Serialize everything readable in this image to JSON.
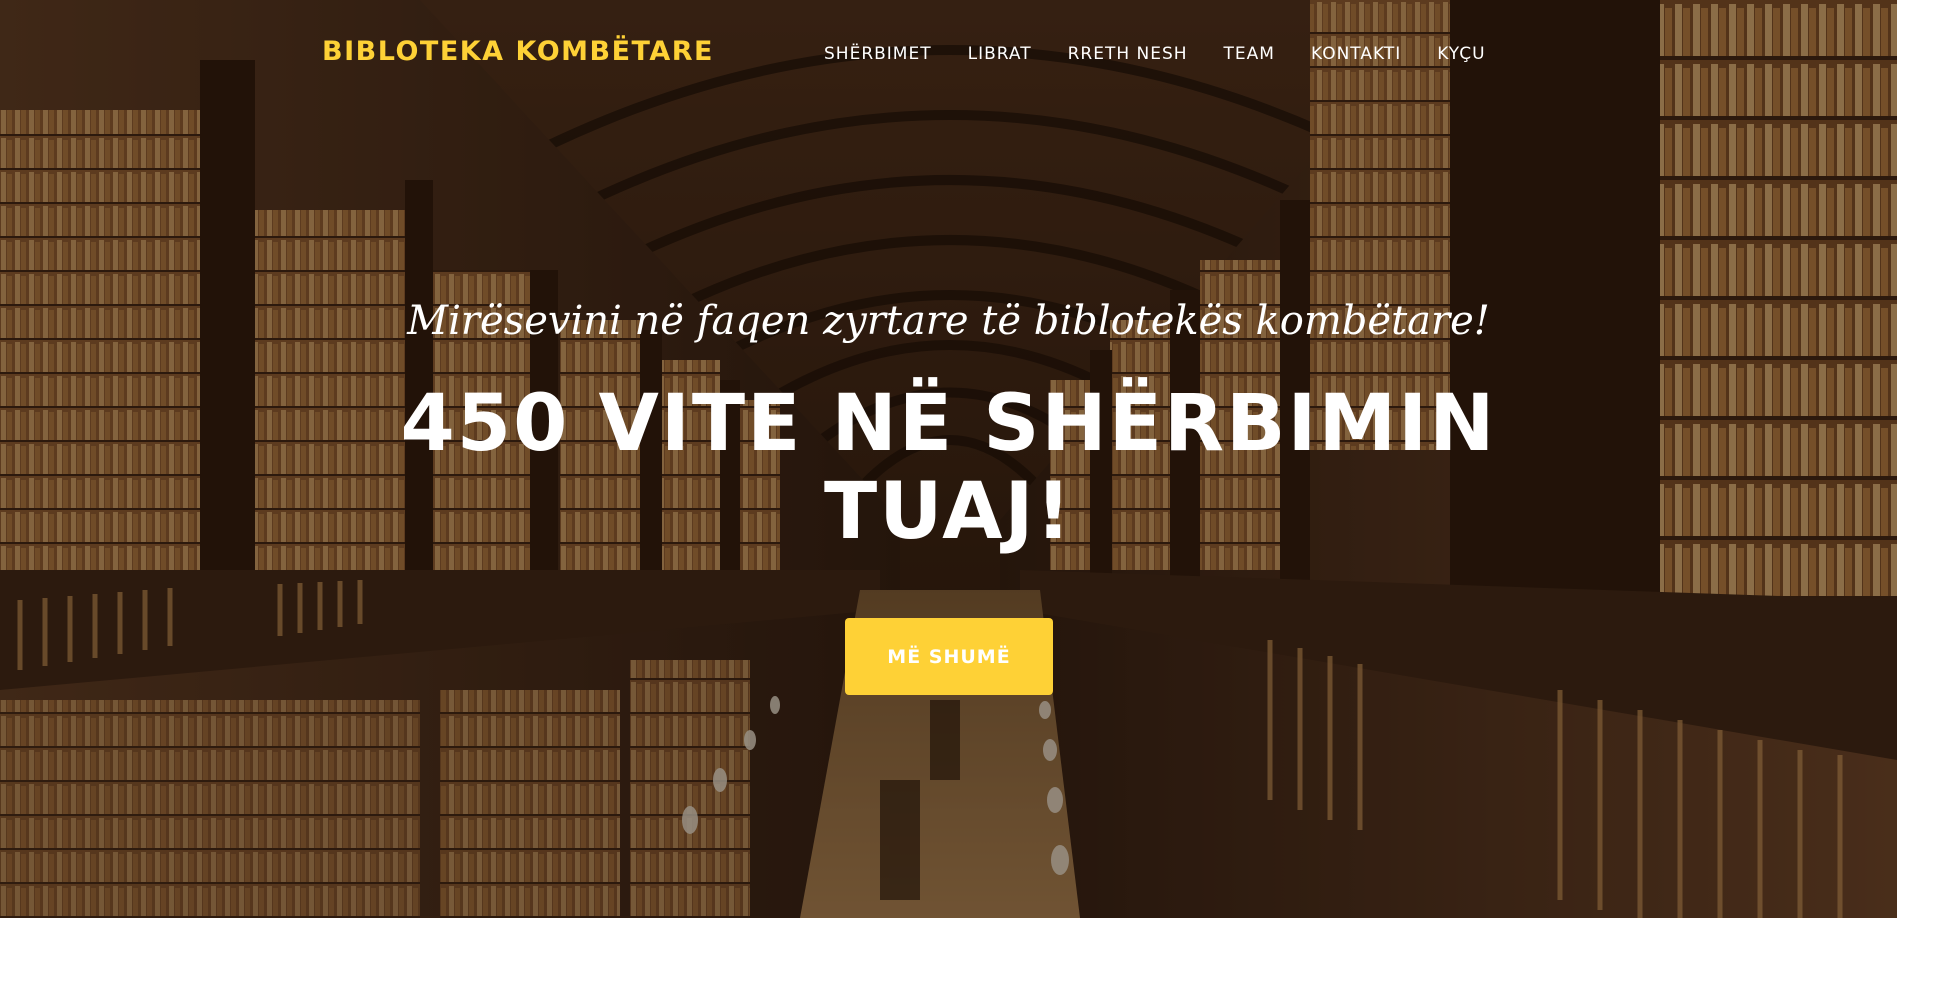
{
  "navbar": {
    "brand": "BIBLOTEKA KOMBËTARE",
    "items": [
      {
        "label": "SHËRBIMET"
      },
      {
        "label": "LIBRAT"
      },
      {
        "label": "RRETH NESH"
      },
      {
        "label": "TEAM"
      },
      {
        "label": "KONTAKTI"
      },
      {
        "label": "KYÇU"
      }
    ]
  },
  "hero": {
    "subheading": "Mirësevini në faqen zyrtare të biblotekës kombëtare!",
    "heading": "450 VITE NË SHËRBIMIN TUAJ!",
    "button_label": "MË SHUMË",
    "background": "library-hall-photo"
  },
  "colors": {
    "accent": "#fed136",
    "text": "#ffffff"
  }
}
